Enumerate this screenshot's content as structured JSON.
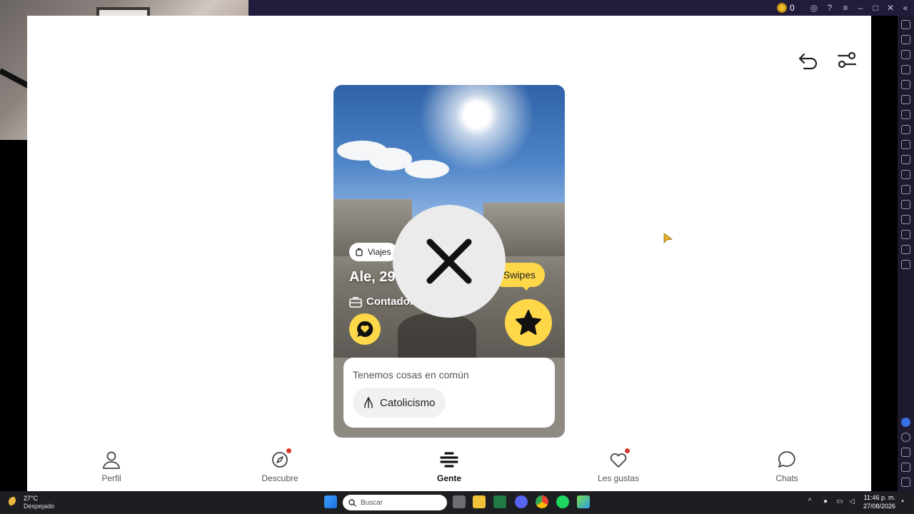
{
  "titlebar": {
    "coin_count": "0"
  },
  "card": {
    "interest_tag": "Viajes",
    "name_age": "Ale, 29",
    "job": "Contador",
    "swipes_bubble": "Swipes",
    "common_title": "Tenemos cosas en común",
    "common_item": "Catolicismo"
  },
  "bottom_nav": {
    "items": [
      {
        "label": "Perfil"
      },
      {
        "label": "Descubre"
      },
      {
        "label": "Gente"
      },
      {
        "label": "Les gustas"
      },
      {
        "label": "Chats"
      }
    ]
  },
  "taskbar": {
    "weather_temp": "27°C",
    "weather_desc": "Despejado",
    "search_placeholder": "Buscar",
    "time": "11:46 p. m.",
    "date": "27/08/2026"
  },
  "colors": {
    "accent_yellow": "#ffd84a",
    "emulator_bar": "#221c3c",
    "notification_dot": "#d93a2b"
  },
  "icons": [
    "undo-icon",
    "filter-icon",
    "close-icon",
    "star-icon",
    "chat-heart-icon",
    "briefcase-icon",
    "hands-praying-icon"
  ]
}
